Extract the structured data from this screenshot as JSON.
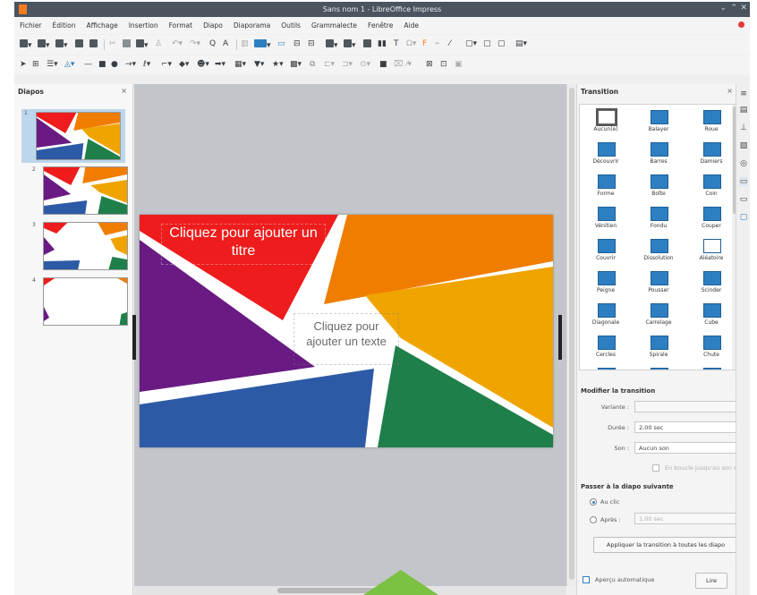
{
  "window": {
    "title": "Sans nom 1 - LibreOffice Impress"
  },
  "menu": [
    "Fichier",
    "Édition",
    "Affichage",
    "Insertion",
    "Format",
    "Diapo",
    "Diaporama",
    "Outils",
    "Grammalecte",
    "Fenêtre",
    "Aide"
  ],
  "slides_pane": {
    "title": "Diapos",
    "slides": [
      "1",
      "2",
      "3",
      "4"
    ]
  },
  "slide": {
    "title_placeholder": "Cliquez pour ajouter un titre",
    "text_placeholder": "Cliquez pour ajouter un texte"
  },
  "transition_pane": {
    "title": "Transition",
    "effects": [
      "Aucun(e)",
      "Balayer",
      "Roue",
      "Découvrir",
      "Barres",
      "Damiers",
      "Forme",
      "Boîte",
      "Coin",
      "Vénitien",
      "Fondu",
      "Couper",
      "Couvrir",
      "Dissolution",
      "Aléatoire",
      "Peigne",
      "Pousser",
      "Scinder",
      "Diagonale",
      "Carrelage",
      "Cube",
      "Cercles",
      "Spirale",
      "Chute"
    ],
    "selected_effect": "Aucun(e)",
    "modify_heading": "Modifier la transition",
    "variant_label": "Variante :",
    "duration_label": "Durée :",
    "duration_value": "2,00 sec",
    "sound_label": "Son :",
    "sound_value": "Aucun son",
    "loop_label": "En boucle jusqu'au son s",
    "advance_heading": "Passer à la diapo suivante",
    "on_click_label": "Au clic",
    "after_label": "Après :",
    "after_value": "1,00 sec",
    "apply_all_label": "Appliquer la transition à toutes les diapo",
    "autopreview_label": "Aperçu automatique",
    "play_label": "Lire"
  },
  "colors": {
    "red": "#ee1c1c",
    "orange": "#f07d00",
    "yellow": "#f0a400",
    "purple": "#6a1a83",
    "green": "#1f7f4a",
    "blue": "#2d5aa6",
    "accent": "#2d7fc1",
    "arrow": "#7cc242"
  }
}
